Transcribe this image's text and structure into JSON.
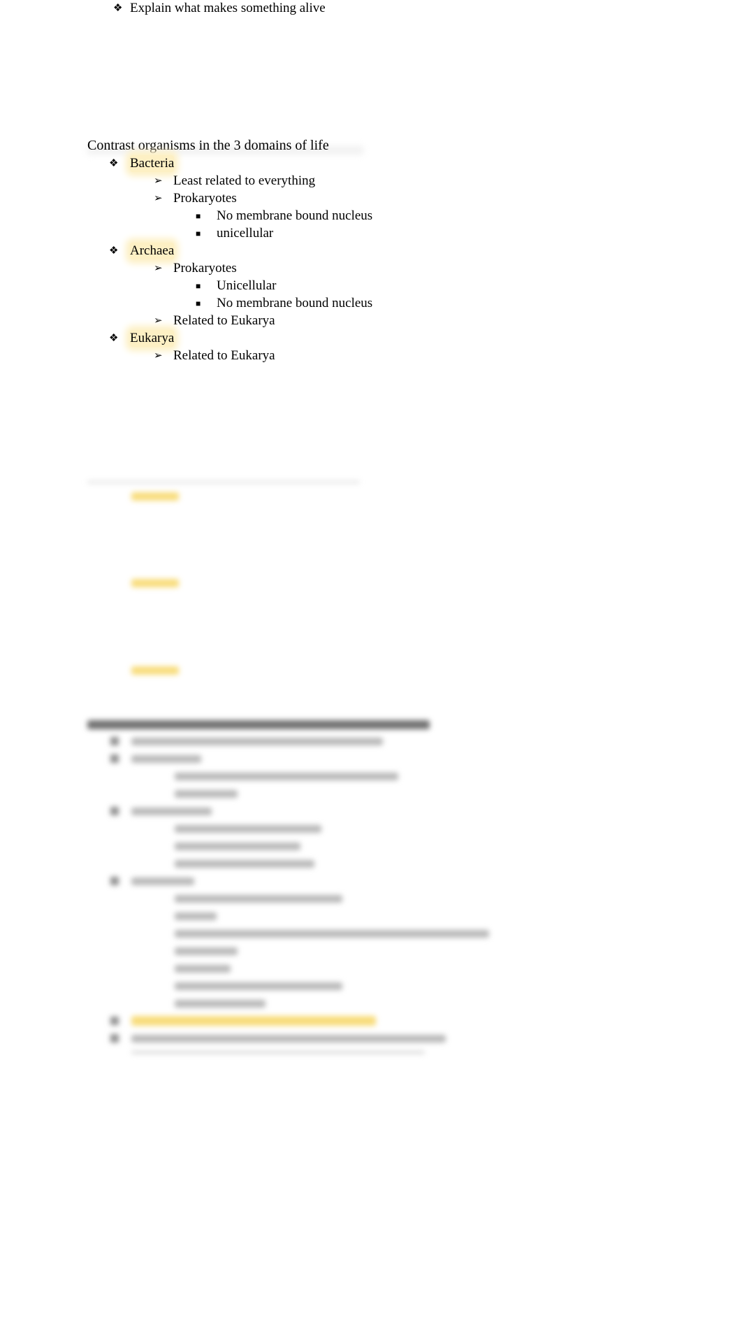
{
  "document": {
    "top_item": {
      "bullet": "❖",
      "text": "Explain what makes something alive"
    },
    "section": {
      "heading": "Contrast organisms in the 3 domains of life",
      "domains": [
        {
          "bullet": "❖",
          "label": "Bacteria",
          "highlighted": true,
          "items": [
            {
              "bullet": "➢",
              "text": "Least related to everything",
              "sub": []
            },
            {
              "bullet": "➢",
              "text": "Prokaryotes",
              "sub": [
                {
                  "bullet": "■",
                  "text": "No membrane bound nucleus"
                },
                {
                  "bullet": "■",
                  "text": "unicellular"
                }
              ]
            }
          ]
        },
        {
          "bullet": "❖",
          "label": "Archaea",
          "highlighted": true,
          "items": [
            {
              "bullet": "➢",
              "text": "Prokaryotes",
              "sub": [
                {
                  "bullet": "■",
                  "text": "Unicellular"
                },
                {
                  "bullet": "■",
                  "text": "No membrane bound nucleus"
                }
              ]
            },
            {
              "bullet": "➢",
              "text": "Related to Eukarya",
              "sub": []
            }
          ]
        },
        {
          "bullet": "❖",
          "label": "Eukarya",
          "highlighted": true,
          "items": [
            {
              "bullet": "➢",
              "text": "Related to Eukarya",
              "sub": []
            }
          ]
        }
      ]
    },
    "blurred_content_note": "Remaining content is blurred and unreadable",
    "highlight_color": "#fdf0c4"
  }
}
